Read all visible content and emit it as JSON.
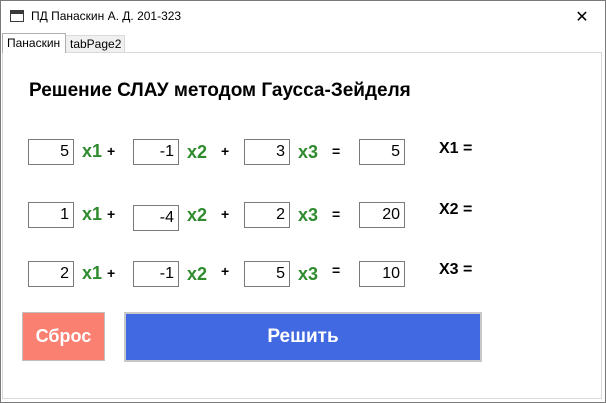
{
  "window": {
    "title": "ПД Панаскин А. Д. 201-323",
    "close_glyph": "✕"
  },
  "tabs": [
    {
      "label": "Панаскин",
      "active": true
    },
    {
      "label": "tabPage2",
      "active": false
    }
  ],
  "heading": "Решение СЛАУ методом Гаусса-Зейделя",
  "equations": [
    {
      "a1": "5",
      "a2": "-1",
      "a3": "3",
      "b": "5",
      "result_label": "X1 ="
    },
    {
      "a1": "1",
      "a2": "-4",
      "a3": "2",
      "b": "20",
      "result_label": "X2 ="
    },
    {
      "a1": "2",
      "a2": "-1",
      "a3": "5",
      "b": "10",
      "result_label": "X3 ="
    }
  ],
  "symbols": {
    "x1": "x1",
    "x2": "x2",
    "x3": "x3",
    "plus": "+",
    "equals": "="
  },
  "buttons": {
    "reset": "Сброс",
    "solve": "Решить"
  },
  "colors": {
    "variable": "#2e8b2e",
    "reset_bg": "#fa8072",
    "solve_bg": "#4169e1"
  }
}
